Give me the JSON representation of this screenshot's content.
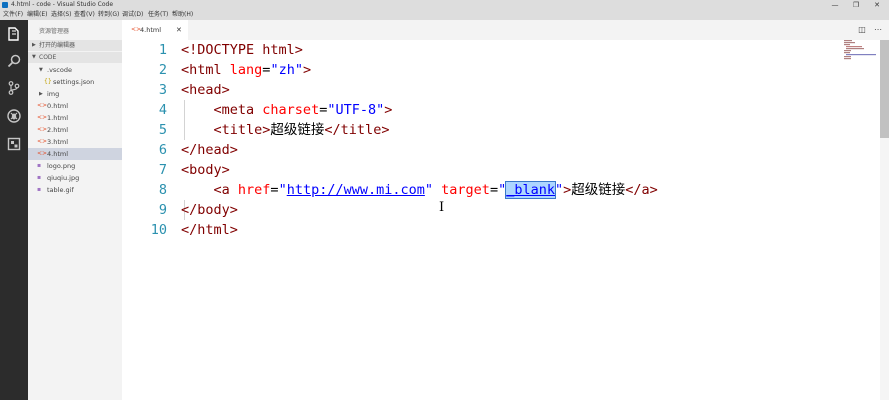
{
  "window": {
    "title": "4.html - code - Visual Studio Code",
    "controls": [
      "—",
      "❐",
      "✕"
    ]
  },
  "menu": [
    "文件(F)",
    "编辑(E)",
    "选择(S)",
    "查看(V)",
    "转到(G)",
    "调试(D)",
    "任务(T)",
    "帮助(H)"
  ],
  "activity_icons": [
    "files-icon",
    "search-icon",
    "source-control-icon",
    "debug-icon",
    "extensions-icon"
  ],
  "sidebar": {
    "title": "资源管理器",
    "open_editors": "打开的编辑器",
    "folder": "CODE",
    "items": [
      {
        "label": ".vscode",
        "kind": "folder-open",
        "depth": 1
      },
      {
        "label": "settings.json",
        "kind": "json",
        "depth": 2
      },
      {
        "label": "img",
        "kind": "folder",
        "depth": 1
      },
      {
        "label": "0.html",
        "kind": "html",
        "depth": 1
      },
      {
        "label": "1.html",
        "kind": "html",
        "depth": 1
      },
      {
        "label": "2.html",
        "kind": "html",
        "depth": 1
      },
      {
        "label": "3.html",
        "kind": "html",
        "depth": 1
      },
      {
        "label": "4.html",
        "kind": "html",
        "depth": 1,
        "active": true
      },
      {
        "label": "logo.png",
        "kind": "image",
        "depth": 1
      },
      {
        "label": "qiuqiu.jpg",
        "kind": "image",
        "depth": 1
      },
      {
        "label": "table.gif",
        "kind": "image",
        "depth": 1
      }
    ]
  },
  "tab": {
    "label": "4.html",
    "close": "✕"
  },
  "editor": {
    "lines": [
      {
        "n": "1",
        "tokens": [
          [
            "tag",
            "<!DOCTYPE html>"
          ]
        ]
      },
      {
        "n": "2",
        "tokens": [
          [
            "tag",
            "<html "
          ],
          [
            "attr",
            "lang"
          ],
          [
            "plain",
            "="
          ],
          [
            "val",
            "\"zh\""
          ],
          [
            "tag",
            ">"
          ]
        ]
      },
      {
        "n": "3",
        "tokens": [
          [
            "tag",
            "<head>"
          ]
        ]
      },
      {
        "n": "4",
        "tokens": [
          [
            "plain",
            "    "
          ],
          [
            "tag",
            "<meta "
          ],
          [
            "attr",
            "charset"
          ],
          [
            "plain",
            "="
          ],
          [
            "val",
            "\"UTF-8\""
          ],
          [
            "tag",
            ">"
          ]
        ]
      },
      {
        "n": "5",
        "tokens": [
          [
            "plain",
            "    "
          ],
          [
            "tag",
            "<title>"
          ],
          [
            "plain",
            "超级链接"
          ],
          [
            "tag",
            "</title>"
          ]
        ]
      },
      {
        "n": "6",
        "tokens": [
          [
            "tag",
            "</head>"
          ]
        ]
      },
      {
        "n": "7",
        "tokens": [
          [
            "tag",
            "<body>"
          ]
        ]
      },
      {
        "n": "8",
        "tokens": [
          [
            "plain",
            "    "
          ],
          [
            "tag",
            "<a "
          ],
          [
            "attr",
            "href"
          ],
          [
            "plain",
            "="
          ],
          [
            "val",
            "\""
          ],
          [
            "link",
            "http://www.mi.com"
          ],
          [
            "val",
            "\""
          ],
          [
            "plain",
            " "
          ],
          [
            "attr",
            "target"
          ],
          [
            "plain",
            "="
          ],
          [
            "val",
            "\""
          ],
          [
            "sel",
            "_blank"
          ],
          [
            "val",
            "\""
          ],
          [
            "tag",
            ">"
          ],
          [
            "plain",
            "超级链接"
          ],
          [
            "tag",
            "</a>"
          ]
        ]
      },
      {
        "n": "9",
        "tokens": [
          [
            "tag",
            "</body>"
          ]
        ]
      },
      {
        "n": "10",
        "tokens": [
          [
            "tag",
            "</html>"
          ]
        ]
      }
    ]
  },
  "colors": {
    "activitybar": "#2c2c2c",
    "sidebar": "#f3f3f3",
    "tag": "#800000",
    "attr": "#ff0000",
    "value": "#0000ff",
    "line_number": "#2b91af",
    "selection": "#add6ff"
  }
}
